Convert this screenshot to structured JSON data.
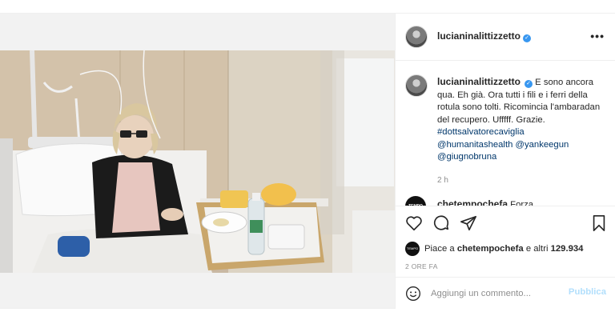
{
  "post": {
    "username": "lucianinalittizzetto",
    "more_label": "•••",
    "caption_lines": [
      "E sono ancora",
      "qua. Eh già. Ora tutti i fili e i ferri della",
      "rotula sono tolti. Ricomincia",
      "l'ambaradan del recupero. Ufffff.",
      "Grazie."
    ],
    "caption_tags": {
      "tag1": "#dottsalvatorecaviglia",
      "tag2": "@humanitashealth",
      "tag3": "@yankeegun",
      "tag4": "@giugnobruna"
    },
    "caption_time": "2 h"
  },
  "comment": {
    "username": "chetempochefa",
    "text": "Forza",
    "avatar_label": "TEMPO"
  },
  "likes": {
    "prefix": "Piace a",
    "user": "chetempochefa",
    "middle": "e altri",
    "count": "129.934"
  },
  "date": "2 ORE FA",
  "comment_box": {
    "placeholder": "Aggiungi un commento...",
    "publish_label": "Pubblica"
  },
  "icons": {
    "more": "more-dots-icon",
    "like": "heart-icon",
    "comment": "comment-bubble-icon",
    "share": "paper-plane-icon",
    "save": "bookmark-icon",
    "emoji": "smiley-icon",
    "verified": "verified-badge-icon"
  },
  "colors": {
    "verified": "#3897f0",
    "link": "#00376b",
    "muted": "#8e8e8e",
    "publish_disabled": "#b2dffc"
  }
}
